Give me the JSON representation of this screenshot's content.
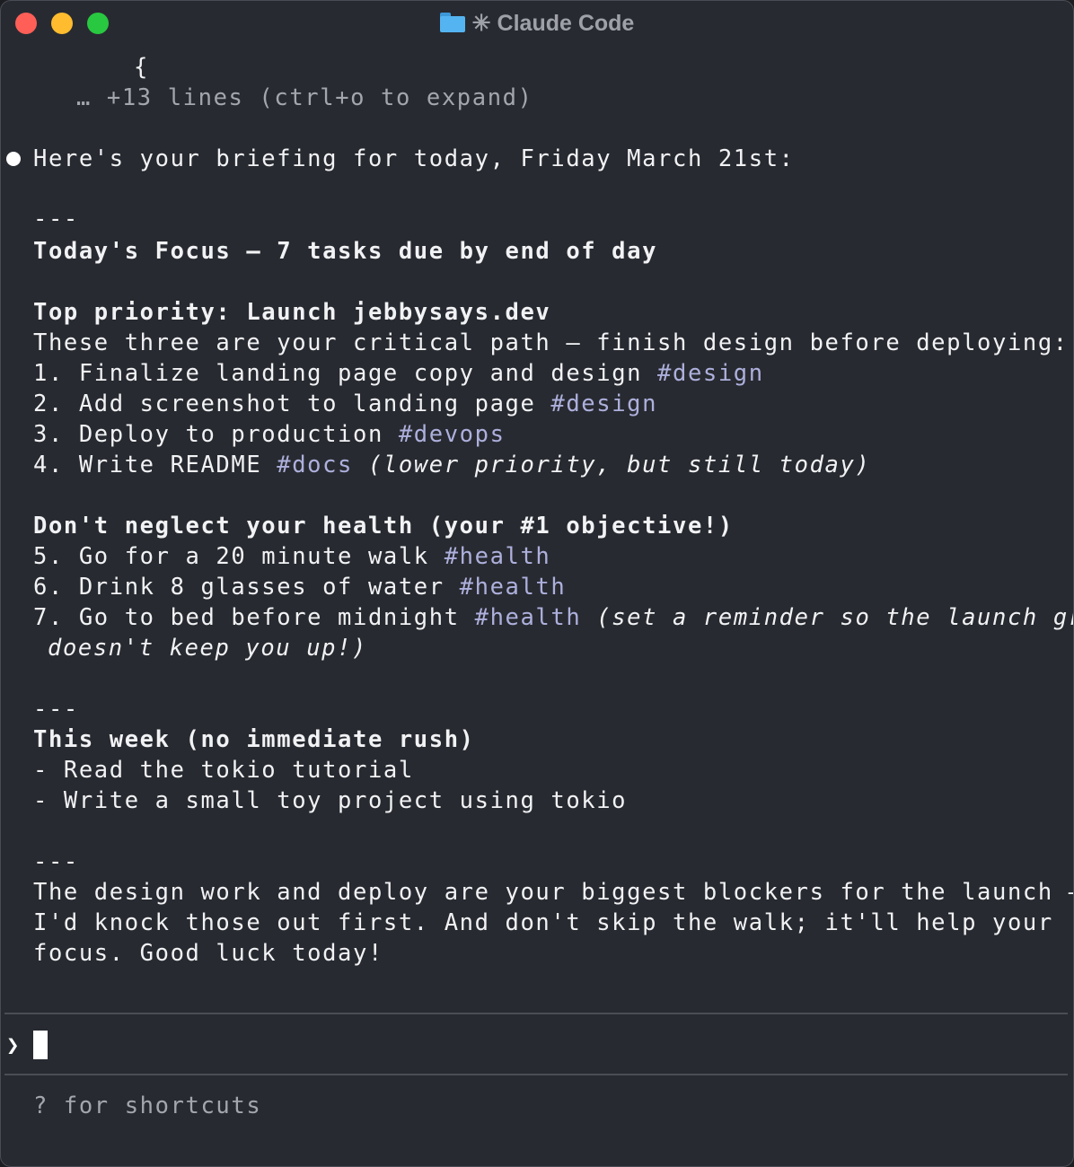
{
  "window": {
    "title": "✳ Claude Code",
    "colors": {
      "background": "#282a31",
      "tag": "#adb0dc",
      "text": "#f1f2f4",
      "dim": "#a3a6ad"
    }
  },
  "collapsed": {
    "brace": "{",
    "more_lines": "… +13 lines (ctrl+o to expand)"
  },
  "response": {
    "intro": "Here's your briefing for today, Friday March 21st:",
    "rule1": "---",
    "heading_focus": "Today's Focus — 7 tasks due by end of day",
    "priority_heading": "Top priority: Launch jebbysays.dev",
    "priority_intro": "These three are your critical path — finish design before deploying:",
    "tasks": [
      {
        "num": "1. ",
        "text": "Finalize landing page copy and design ",
        "tag": "#design",
        "note": ""
      },
      {
        "num": "2. ",
        "text": "Add screenshot to landing page ",
        "tag": "#design",
        "note": ""
      },
      {
        "num": "3. ",
        "text": "Deploy to production ",
        "tag": "#devops",
        "note": ""
      },
      {
        "num": "4. ",
        "text": "Write README ",
        "tag": "#docs",
        "note": " (lower priority, but still today)"
      },
      {
        "num": "5. ",
        "text": "Go for a 20 minute walk ",
        "tag": "#health",
        "note": ""
      },
      {
        "num": "6. ",
        "text": "Drink 8 glasses of water ",
        "tag": "#health",
        "note": ""
      },
      {
        "num": "7. ",
        "text": "Go to bed before midnight ",
        "tag": "#health",
        "note": " (set a reminder so the launch grind",
        "note_cont": "doesn't keep you up!)"
      }
    ],
    "health_heading": "Don't neglect your health (your #1 objective!)",
    "rule2": "---",
    "week_heading": "This week (no immediate rush)",
    "week_items": [
      "- Read the tokio tutorial",
      "- Write a small toy project using tokio"
    ],
    "rule3": "---",
    "closing": [
      "The design work and deploy are your biggest blockers for the launch —",
      "I'd knock those out first. And don't skip the walk; it'll help your",
      "focus. Good luck today!"
    ]
  },
  "input": {
    "prompt_symbol": "❯",
    "value": ""
  },
  "footer": {
    "hint": "? for shortcuts"
  }
}
